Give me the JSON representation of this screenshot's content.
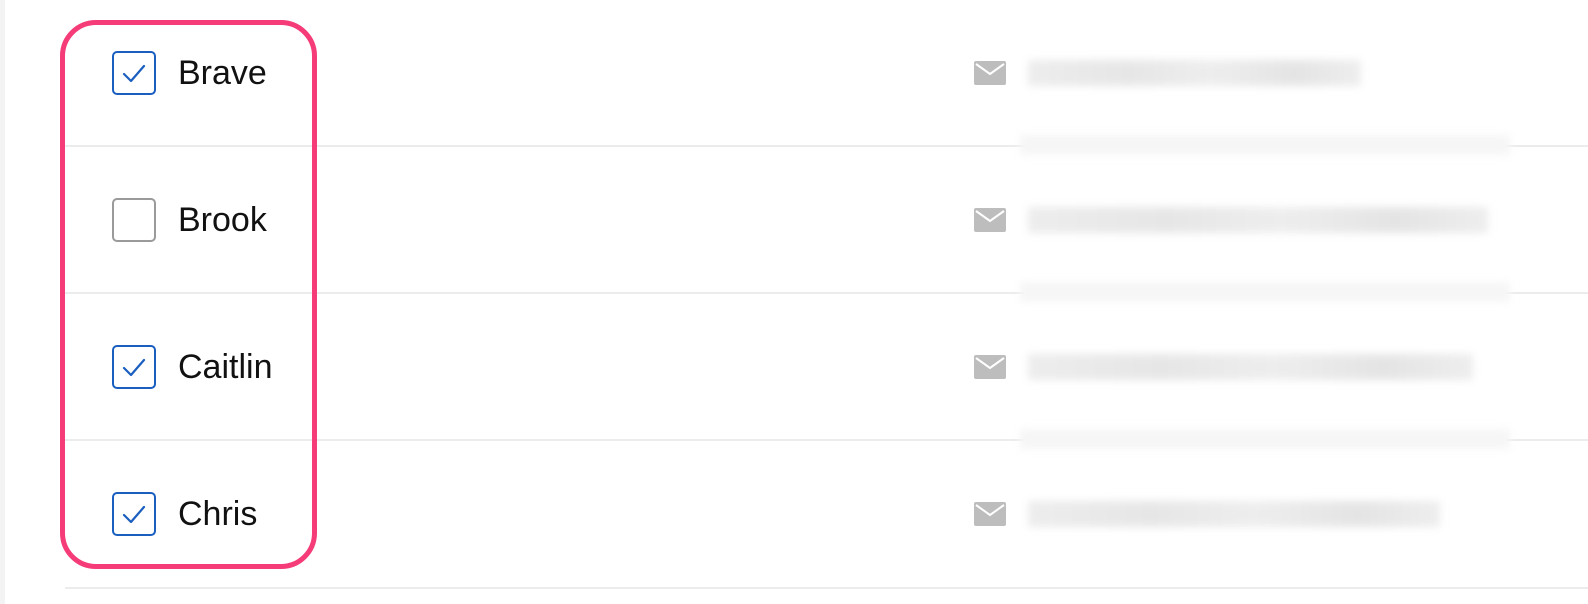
{
  "contacts": [
    {
      "name": "Brave",
      "checked": true,
      "email": "████████████████████"
    },
    {
      "name": "Brook",
      "checked": false,
      "email": "████████████████████████████"
    },
    {
      "name": "Caitlin",
      "checked": true,
      "email": "█████████████████████████"
    },
    {
      "name": "Chris",
      "checked": true,
      "email": "██████████████████████████"
    }
  ],
  "icons": {
    "checkbox": "checkbox-icon",
    "mail": "mail-icon"
  },
  "colors": {
    "checkbox_checked": "#1a5fbf",
    "checkbox_unchecked": "#9a9a9a",
    "highlight": "#f53b78",
    "mail_icon": "#bdbdbd"
  }
}
